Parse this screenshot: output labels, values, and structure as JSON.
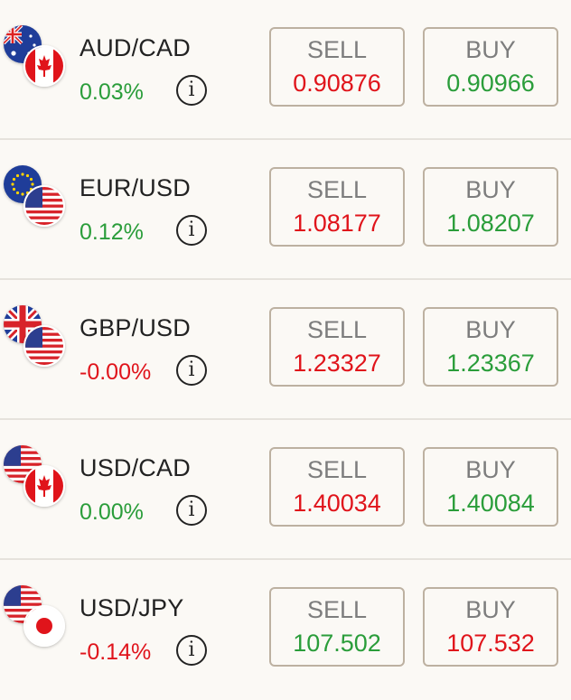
{
  "instruments": [
    {
      "pair": "AUD/CAD",
      "change": "0.03%",
      "trend": "up",
      "flags": [
        "flag-au",
        "flag-ca"
      ],
      "sell_label": "SELL",
      "sell_price": "0.90876",
      "sell_color": "down",
      "buy_label": "BUY",
      "buy_price": "0.90966",
      "buy_color": "up"
    },
    {
      "pair": "EUR/USD",
      "change": "0.12%",
      "trend": "up",
      "flags": [
        "flag-eu",
        "flag-us"
      ],
      "sell_label": "SELL",
      "sell_price": "1.08177",
      "sell_color": "down",
      "buy_label": "BUY",
      "buy_price": "1.08207",
      "buy_color": "up"
    },
    {
      "pair": "GBP/USD",
      "change": "-0.00%",
      "trend": "down",
      "flags": [
        "flag-gb",
        "flag-us"
      ],
      "sell_label": "SELL",
      "sell_price": "1.23327",
      "sell_color": "down",
      "buy_label": "BUY",
      "buy_price": "1.23367",
      "buy_color": "up"
    },
    {
      "pair": "USD/CAD",
      "change": "0.00%",
      "trend": "up",
      "flags": [
        "flag-us",
        "flag-ca"
      ],
      "sell_label": "SELL",
      "sell_price": "1.40034",
      "sell_color": "down",
      "buy_label": "BUY",
      "buy_price": "1.40084",
      "buy_color": "up"
    },
    {
      "pair": "USD/JPY",
      "change": "-0.14%",
      "trend": "down",
      "flags": [
        "flag-us",
        "flag-jp"
      ],
      "sell_label": "SELL",
      "sell_price": "107.502",
      "sell_color": "up",
      "buy_label": "BUY",
      "buy_price": "107.532",
      "buy_color": "down"
    }
  ],
  "info_glyph": "i",
  "colors": {
    "up": "#2a9d3a",
    "down": "#e0141b",
    "button_border": "#bdb1a1",
    "background": "#fbf9f5"
  }
}
